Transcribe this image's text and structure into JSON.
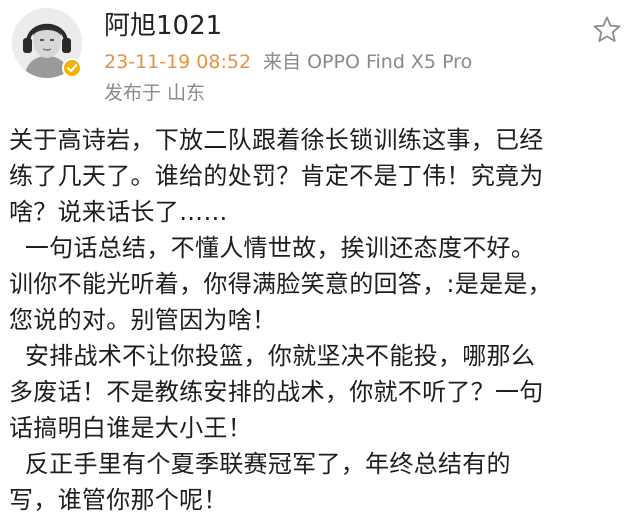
{
  "author": {
    "name": "阿旭1021",
    "verified_color": "#f5b400"
  },
  "post_meta": {
    "timestamp": "23-11-19 08:52",
    "source": "来自 OPPO Find X5 Pro",
    "location": "发布于 山东"
  },
  "icons": {
    "avatar": "avatar-headphones-portrait",
    "verified": "verified-badge-icon",
    "favorite": "star-icon"
  },
  "colors": {
    "timestamp": "#e8923e",
    "meta_text": "#8a8a8a",
    "body_text": "#1e1e1e"
  },
  "body": {
    "lines": [
      "关于高诗岩，下放二队跟着徐长锁训练这事，已经",
      "练了几天了。谁给的处罚？肯定不是丁伟！究竟为",
      "啥？说来话长了……",
      "  一句话总结，不懂人情世故，挨训还态度不好。",
      "训你不能光听着，你得满脸笑意的回答，:是是是，",
      "您说的对。别管因为啥！",
      "  安排战术不让你投篮，你就坚决不能投，哪那么",
      "多废话！不是教练安排的战术，你就不听了？一句",
      "话搞明白谁是大小王！",
      "  反正手里有个夏季联赛冠军了，年终总结有的",
      "写，谁管你那个呢！"
    ]
  }
}
